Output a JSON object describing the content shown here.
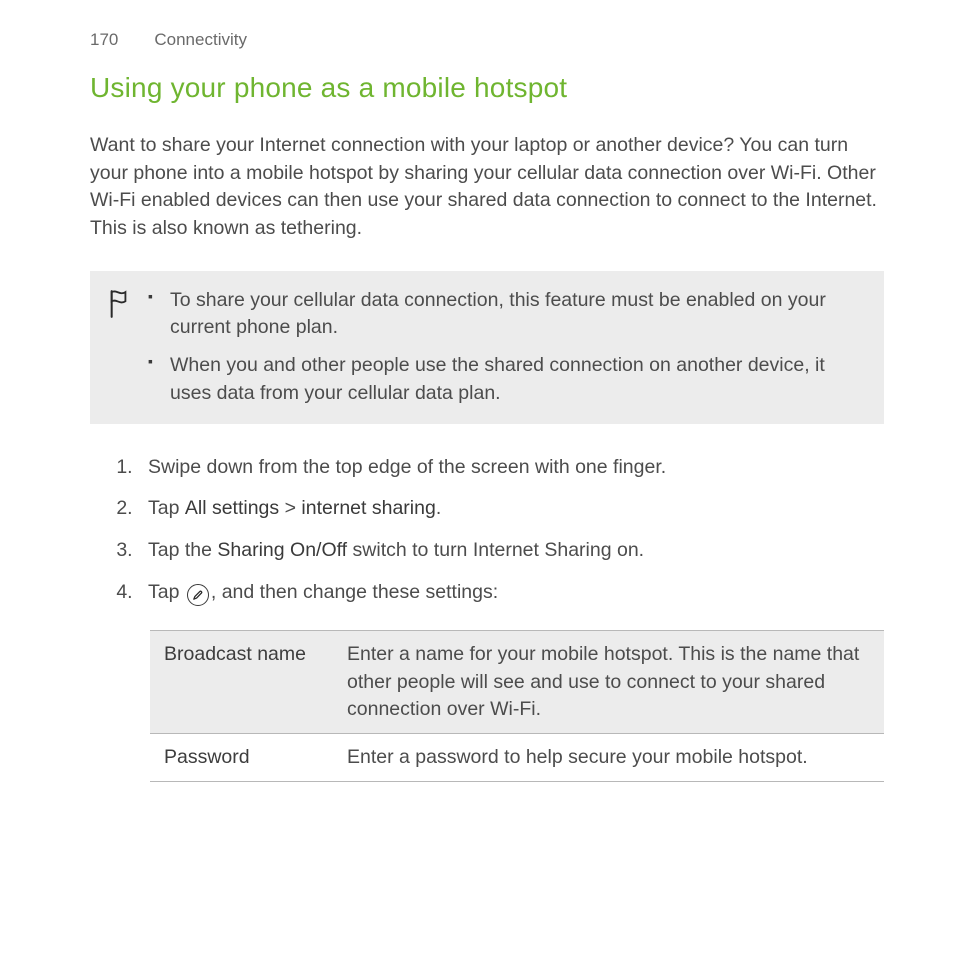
{
  "header": {
    "page_number": "170",
    "section": "Connectivity"
  },
  "title": "Using your phone as a mobile hotspot",
  "intro": "Want to share your Internet connection with your laptop or another device? You can turn your phone into a mobile hotspot by sharing your cellular data connection over Wi-Fi. Other Wi-Fi enabled devices can then use your shared data connection to connect to the Internet. This is also known as tethering.",
  "notes": [
    "To share your cellular data connection, this feature must be enabled on your current phone plan.",
    "When you and other people use the shared connection on another device, it uses data from your cellular data plan."
  ],
  "steps": {
    "s1": "Swipe down from the top edge of the screen with one finger.",
    "s2_pre": "Tap ",
    "s2_kw1": "All settings",
    "s2_sep": " > ",
    "s2_kw2": "internet sharing",
    "s2_post": ".",
    "s3_pre": "Tap the ",
    "s3_kw": "Sharing On/Off",
    "s3_post": " switch to turn Internet Sharing on.",
    "s4_pre": "Tap ",
    "s4_post": ", and then change these settings:"
  },
  "table": {
    "rows": [
      {
        "label": "Broadcast name",
        "desc": "Enter a name for your mobile hotspot. This is the name that other people will see and use to connect to your shared connection over Wi-Fi."
      },
      {
        "label": "Password",
        "desc": "Enter a password to help secure your mobile hotspot."
      }
    ]
  }
}
